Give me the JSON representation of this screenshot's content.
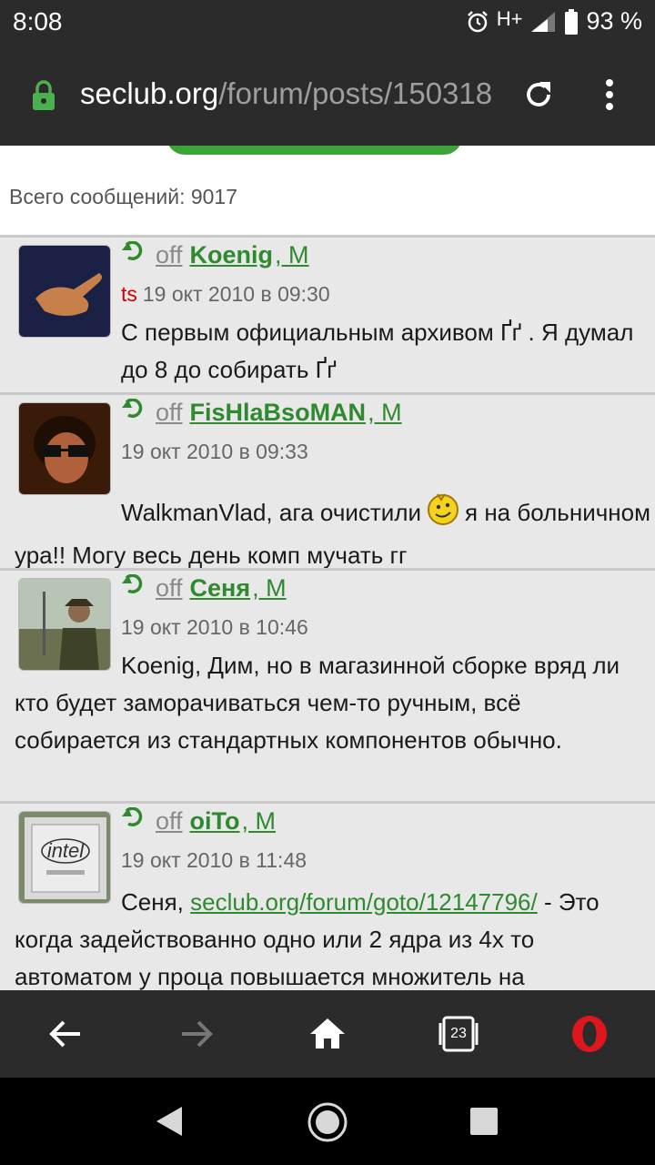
{
  "status": {
    "time": "8:08",
    "network": "H+",
    "battery": "93 %",
    "icons": [
      "alarm-icon",
      "signal-icon",
      "battery-icon"
    ]
  },
  "browser": {
    "url_domain": "seclub.org",
    "url_path": "/forum/posts/150318",
    "icons": [
      "lock-icon",
      "reload-icon",
      "menu-icon"
    ]
  },
  "page": {
    "total_messages": "Всего сообщений: 9017"
  },
  "posts": [
    {
      "status": "off",
      "username": "Koenig",
      "gender": ", М",
      "ts": "ts",
      "date": "19 окт 2010 в 09:30",
      "text": "С первым официальным архивом Ґґ . Я думал до 8 до собирать Ґґ"
    },
    {
      "status": "off",
      "username": "FisHlaBsoMAN",
      "gender": ", М",
      "date": "19 окт 2010 в 09:33",
      "text_before": "WalkmanVlad, ага очистили",
      "text_after": "я на больничном ура!! Могу весь день комп мучать гг"
    },
    {
      "status": "off",
      "username": "Сеня",
      "gender": ", М",
      "date": "19 окт 2010 в 10:46",
      "text": "Koenig, Дим, но в магазинной сборке вряд ли кто будет заморачиваться чем-то ручным, всё собирается из стандартных компонентов обычно."
    },
    {
      "status": "off",
      "username": "oiTo",
      "gender": ", М",
      "date": "19 окт 2010 в 11:48",
      "text_before": "Сеня,",
      "link": "seclub.org/forum/goto/12147796/",
      "text_after": "- Это когда задействованно одно или 2 ядра из 4х то автоматом у проца повышается множитель на"
    }
  ],
  "toolbar": {
    "tabs_count": "23",
    "icons": [
      "back-icon",
      "forward-icon",
      "home-icon",
      "tabs-icon",
      "opera-icon"
    ]
  },
  "navbar": {
    "icons": [
      "nav-back-icon",
      "nav-home-icon",
      "nav-recents-icon"
    ]
  },
  "colors": {
    "chrome": "#2b2b2b",
    "accent_green": "#2f8a2f",
    "post_background": "#e8e8e8",
    "ts_red": "#d40000"
  }
}
